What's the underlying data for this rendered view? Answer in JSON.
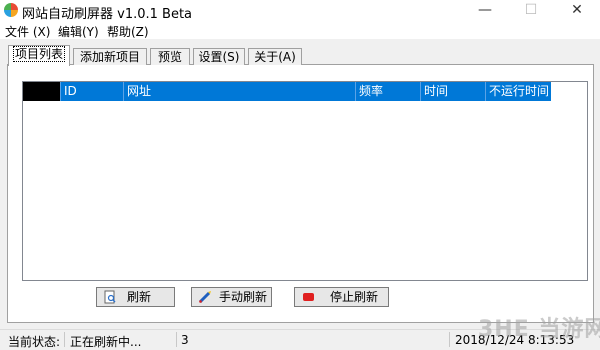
{
  "window": {
    "title": "网站自动刷屏器 v1.0.1 Beta",
    "min_glyph": "—",
    "max_glyph": "☐",
    "close_glyph": "✕"
  },
  "menu": [
    "文件 (X)",
    "编辑(Y)",
    "帮助(Z)"
  ],
  "tabs": [
    "项目列表",
    "添加新项目",
    "预览",
    "设置(S)",
    "关于(A)"
  ],
  "active_tab_index": 0,
  "list": {
    "columns": [
      "ID",
      "网址",
      "频率",
      "时间",
      "不运行时间"
    ],
    "rows": []
  },
  "buttons": {
    "refresh": "刷新",
    "manual_refresh": "手动刷新",
    "stop_refresh": "停止刷新"
  },
  "status": {
    "label": "当前状态:",
    "state": "正在刷新中...",
    "count": "3",
    "datetime": "2018/12/24 8:13:53"
  },
  "watermark": "3HE 当游网",
  "colors": {
    "header_blue": "#0078d7",
    "window_bg": "#f0f0f0",
    "stop_icon_red": "#e02020"
  }
}
